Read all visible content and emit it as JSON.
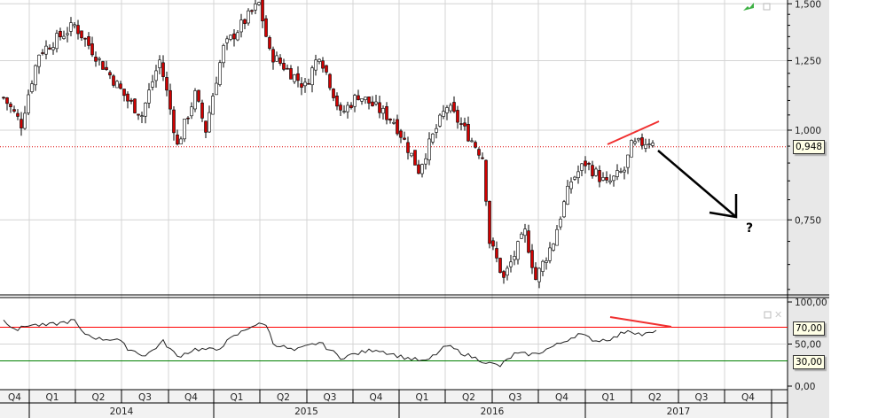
{
  "chart_data": {
    "type": "candlestick",
    "scale": "log",
    "price_axis": {
      "ticks": [
        "1,500",
        "1,250",
        "1,000",
        "0,750"
      ],
      "tick_values": [
        1.5,
        1.25,
        1.0,
        0.75
      ],
      "last_price_label": "0,948",
      "last_price": 0.948
    },
    "price_keypoints_week_close": [
      [
        0,
        1.11
      ],
      [
        5,
        1.02
      ],
      [
        10,
        1.28
      ],
      [
        20,
        1.4
      ],
      [
        27,
        1.25
      ],
      [
        35,
        1.1
      ],
      [
        39,
        1.05
      ],
      [
        44,
        1.25
      ],
      [
        49,
        0.95
      ],
      [
        54,
        1.12
      ],
      [
        57,
        1.0
      ],
      [
        62,
        1.3
      ],
      [
        72,
        1.5
      ],
      [
        75,
        1.28
      ],
      [
        85,
        1.15
      ],
      [
        89,
        1.28
      ],
      [
        95,
        1.05
      ],
      [
        100,
        1.12
      ],
      [
        110,
        1.03
      ],
      [
        117,
        0.88
      ],
      [
        125,
        1.08
      ],
      [
        130,
        1.0
      ],
      [
        135,
        0.92
      ],
      [
        137,
        0.7
      ],
      [
        141,
        0.62
      ],
      [
        147,
        0.72
      ],
      [
        150,
        0.62
      ],
      [
        155,
        0.7
      ],
      [
        160,
        0.85
      ],
      [
        164,
        0.9
      ],
      [
        170,
        0.84
      ],
      [
        175,
        0.88
      ],
      [
        177,
        0.95
      ],
      [
        183,
        0.97
      ]
    ],
    "rsi": {
      "ticks": [
        "100,00",
        "50,00",
        "0,00"
      ],
      "tick_values": [
        100,
        50,
        0
      ],
      "overbought_label": "70,00",
      "overbought": 70,
      "oversold_label": "30,00",
      "oversold": 30,
      "keypoints_week_value": [
        [
          0,
          78
        ],
        [
          4,
          67
        ],
        [
          7,
          73
        ],
        [
          12,
          72
        ],
        [
          20,
          78
        ],
        [
          22,
          64
        ],
        [
          27,
          56
        ],
        [
          32,
          56
        ],
        [
          35,
          45
        ],
        [
          40,
          36
        ],
        [
          45,
          53
        ],
        [
          49,
          35
        ],
        [
          54,
          44
        ],
        [
          60,
          43
        ],
        [
          64,
          56
        ],
        [
          70,
          72
        ],
        [
          74,
          74
        ],
        [
          76,
          51
        ],
        [
          82,
          42
        ],
        [
          89,
          52
        ],
        [
          95,
          34
        ],
        [
          99,
          38
        ],
        [
          105,
          44
        ],
        [
          112,
          35
        ],
        [
          119,
          29
        ],
        [
          125,
          48
        ],
        [
          130,
          38
        ],
        [
          137,
          27
        ],
        [
          140,
          24
        ],
        [
          144,
          38
        ],
        [
          150,
          38
        ],
        [
          157,
          51
        ],
        [
          162,
          62
        ],
        [
          167,
          54
        ],
        [
          172,
          57
        ],
        [
          176,
          67
        ],
        [
          180,
          61
        ],
        [
          184,
          64
        ]
      ]
    },
    "x_axis": {
      "quarters": [
        "Q4",
        "Q1",
        "Q2",
        "Q3",
        "Q4",
        "Q1",
        "Q2",
        "Q3",
        "Q4",
        "Q1",
        "Q2",
        "Q3",
        "Q4",
        "Q1",
        "Q2",
        "Q3",
        "Q4"
      ],
      "years": [
        "2014",
        "2015",
        "2016",
        "2017"
      ]
    },
    "annotation": "?",
    "colors": {
      "up": "#2e7d32",
      "down": "#d00000",
      "rsi_over": "#ff0000",
      "rsi_under": "#008000"
    }
  }
}
